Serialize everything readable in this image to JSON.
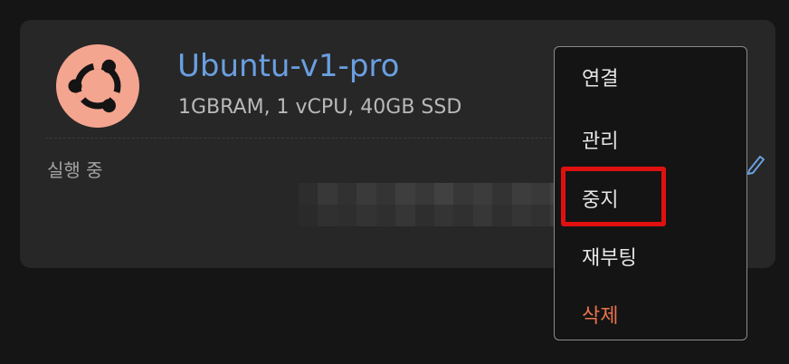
{
  "instance": {
    "name": "Ubuntu-v1-pro",
    "specs": "1GBRAM, 1 vCPU, 40GB SSD",
    "status": "실행 중",
    "logo_icon": "ubuntu-logo",
    "logo_bg_color": "#f4a58f"
  },
  "menu": {
    "items": [
      {
        "label": "연결"
      },
      {
        "label": "관리"
      },
      {
        "label": "중지"
      },
      {
        "label": "재부팅"
      },
      {
        "label": "삭제"
      }
    ],
    "danger_color": "#e8734d"
  },
  "highlight": {
    "target": "중지",
    "color": "#e01010"
  },
  "accent_color": "#6a9fe0"
}
